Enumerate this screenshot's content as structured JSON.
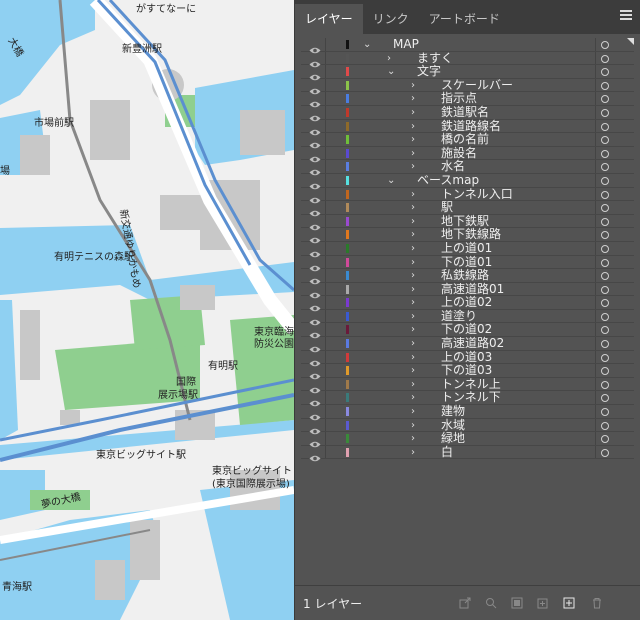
{
  "map": {
    "labels": [
      {
        "id": "label-gasutenani",
        "text": "がすてなーに"
      },
      {
        "id": "label-shintoyosu",
        "text": "新豊洲駅"
      },
      {
        "id": "label-shijomae",
        "text": "市場前駅"
      },
      {
        "id": "label-yurikamome",
        "text": "新交通ゆりかもめ"
      },
      {
        "id": "label-ariake-tennis",
        "text": "有明テニスの森駅"
      },
      {
        "id": "label-tokyo-rinkai",
        "text": "東京臨海"
      },
      {
        "id": "label-bousai",
        "text": "防災公園"
      },
      {
        "id": "label-ariake",
        "text": "有明駅"
      },
      {
        "id": "label-kokusai",
        "text": "国際"
      },
      {
        "id": "label-tenjijo",
        "text": "展示場駅"
      },
      {
        "id": "label-bigsight-st",
        "text": "東京ビッグサイト駅"
      },
      {
        "id": "label-bigsight",
        "text": "東京ビッグサイト"
      },
      {
        "id": "label-kokusai-tenjijo",
        "text": "(東京国際展示場)"
      },
      {
        "id": "label-yume",
        "text": "夢の大橋"
      },
      {
        "id": "label-aomi",
        "text": "青海駅"
      },
      {
        "id": "label-fragment-1",
        "text": "大橋"
      },
      {
        "id": "label-fragment-2",
        "text": "場"
      }
    ]
  },
  "panel": {
    "tabs": [
      {
        "label": "レイヤー",
        "active": true
      },
      {
        "label": "リンク",
        "active": false
      },
      {
        "label": "アートボード",
        "active": false
      }
    ],
    "layers": [
      {
        "name": "MAP",
        "color": "#111111",
        "level": 0,
        "expanded": true
      },
      {
        "name": "ますく",
        "color": "#555555",
        "level": 1,
        "expanded": false
      },
      {
        "name": "文字",
        "color": "#e04a4a",
        "level": 1,
        "expanded": true
      },
      {
        "name": "スケールバー",
        "color": "#8bc34a",
        "level": 2,
        "expanded": false
      },
      {
        "name": "指示点",
        "color": "#4a7de0",
        "level": 2,
        "expanded": false
      },
      {
        "name": "鉄道駅名",
        "color": "#c0392b",
        "level": 2,
        "expanded": false
      },
      {
        "name": "鉄道路線名",
        "color": "#8e6a2a",
        "level": 2,
        "expanded": false
      },
      {
        "name": "橋の名前",
        "color": "#6fbf3a",
        "level": 2,
        "expanded": false
      },
      {
        "name": "施設名",
        "color": "#5a4ad0",
        "level": 2,
        "expanded": false
      },
      {
        "name": "水名",
        "color": "#5a7ee0",
        "level": 2,
        "expanded": false
      },
      {
        "name": "ベースmap",
        "color": "#56e0e0",
        "level": 1,
        "expanded": true
      },
      {
        "name": "トンネル入口",
        "color": "#c0661e",
        "level": 2,
        "expanded": false
      },
      {
        "name": "駅",
        "color": "#b08a5a",
        "level": 2,
        "expanded": false
      },
      {
        "name": "地下鉄駅",
        "color": "#9a4ad0",
        "level": 2,
        "expanded": false
      },
      {
        "name": "地下鉄線路",
        "color": "#e0781e",
        "level": 2,
        "expanded": false
      },
      {
        "name": "上の道01",
        "color": "#2a7a2a",
        "level": 2,
        "expanded": false
      },
      {
        "name": "下の道01",
        "color": "#d04a9a",
        "level": 2,
        "expanded": false
      },
      {
        "name": "私鉄線路",
        "color": "#3a8ad0",
        "level": 2,
        "expanded": false
      },
      {
        "name": "高速道路01",
        "color": "#aaaaaa",
        "level": 2,
        "expanded": false
      },
      {
        "name": "上の道02",
        "color": "#7a3ad0",
        "level": 2,
        "expanded": false
      },
      {
        "name": "道塗り",
        "color": "#3a5ad0",
        "level": 2,
        "expanded": false
      },
      {
        "name": "下の道02",
        "color": "#6a1a3a",
        "level": 2,
        "expanded": false
      },
      {
        "name": "高速道路02",
        "color": "#5a7ae0",
        "level": 2,
        "expanded": false
      },
      {
        "name": "上の道03",
        "color": "#d03a3a",
        "level": 2,
        "expanded": false
      },
      {
        "name": "下の道03",
        "color": "#e09a2a",
        "level": 2,
        "expanded": false
      },
      {
        "name": "トンネル上",
        "color": "#a07a4a",
        "level": 2,
        "expanded": false
      },
      {
        "name": "トンネル下",
        "color": "#3a7a7a",
        "level": 2,
        "expanded": false
      },
      {
        "name": "建物",
        "color": "#8a8ae0",
        "level": 2,
        "expanded": false
      },
      {
        "name": "水域",
        "color": "#5a5ad0",
        "level": 2,
        "expanded": false
      },
      {
        "name": "緑地",
        "color": "#3a8a3a",
        "level": 2,
        "expanded": false
      },
      {
        "name": "白",
        "color": "#e0a0b0",
        "level": 2,
        "expanded": false
      }
    ],
    "footer": {
      "layer_count": "1 レイヤー",
      "icons": [
        "export-icon",
        "search-layer-icon",
        "clipping-mask-icon",
        "new-sublayer-icon",
        "new-layer-icon",
        "trash-icon"
      ]
    }
  }
}
